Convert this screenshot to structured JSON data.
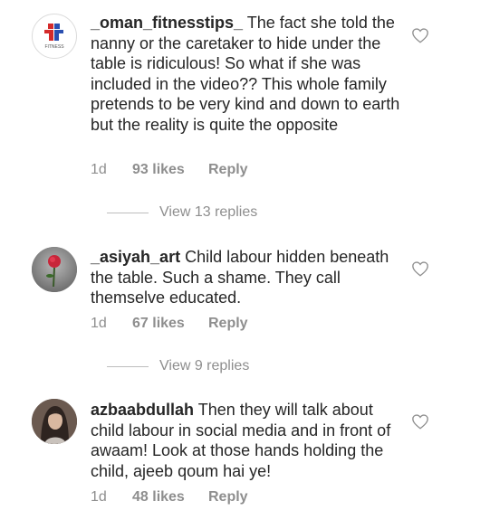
{
  "comments": [
    {
      "username": "_oman_fitnesstips_",
      "text": "The fact she told the nanny or the caretaker to hide under the table is ridiculous! So what if she was included in the video?? This whole family pretends to be very kind and down to earth but the reality is quite the opposite",
      "time": "1d",
      "likes": "93 likes",
      "reply": "Reply",
      "view_replies": "View 13 replies",
      "avatar_logo_text": "FITNESS"
    },
    {
      "username": "_asiyah_art",
      "text": "Child labour hidden beneath the table. Such a shame. They call themselve educated.",
      "time": "1d",
      "likes": "67 likes",
      "reply": "Reply",
      "view_replies": "View 9 replies"
    },
    {
      "username": "azbaabdullah",
      "text": "Then they will talk about child labour in social media and in front of awaam! Look at those hands holding the child, ajeeb qoum hai ye!",
      "time": "1d",
      "likes": "48 likes",
      "reply": "Reply"
    }
  ],
  "icons": {
    "like": "heart-outline-icon"
  },
  "colors": {
    "text": "#262626",
    "muted": "#8e8e8e",
    "background": "#ffffff"
  }
}
